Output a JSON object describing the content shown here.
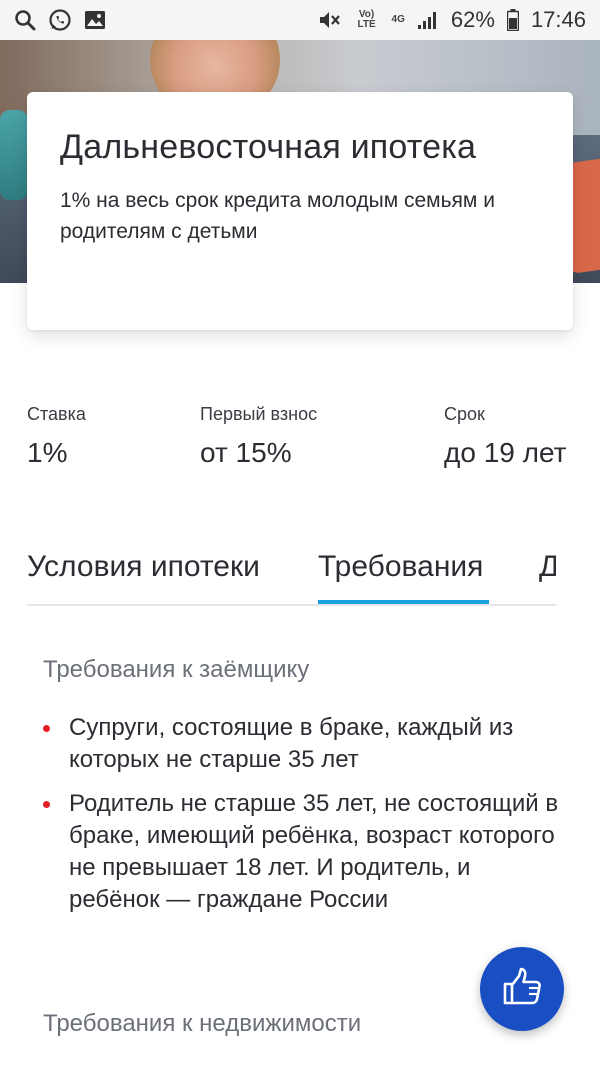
{
  "status_bar": {
    "battery": "62%",
    "time": "17:46",
    "volte_label": "Vo) LTE",
    "network_label": "4G",
    "icons": [
      "search-icon",
      "whatsapp-icon",
      "gallery-icon",
      "mute-icon",
      "signal-icon",
      "battery-icon"
    ]
  },
  "card": {
    "title": "Дальневосточная ипотека",
    "description": "1% на весь срок кредита молодым семьям и родителям с детьми"
  },
  "stats": [
    {
      "label": "Ставка",
      "value": "1%"
    },
    {
      "label": "Первый взнос",
      "value": "от 15%"
    },
    {
      "label": "Срок",
      "value": "до 19 лет"
    }
  ],
  "tabs": [
    {
      "label": "Условия ипотеки",
      "active": false
    },
    {
      "label": "Требования",
      "active": true
    },
    {
      "label": "Д",
      "active": false
    }
  ],
  "content": {
    "borrower_heading": "Требования к заёмщику",
    "requirements": [
      "Супруги, состоящие в браке, каждый из которых не старше 35 лет",
      "Родитель не старше 35 лет, не состоящий в браке, имеющий ребёнка, возраст которого не превышает 18 лет. И родитель, и ребёнок — граждане России"
    ],
    "property_heading": "Требования к недвижимости"
  },
  "fab": {
    "icon": "thumbs-up-icon"
  },
  "colors": {
    "accent": "#1ba0e1",
    "bullet": "#e31e24",
    "fab": "#1a4fc4",
    "heading_gray": "#6b7079"
  }
}
